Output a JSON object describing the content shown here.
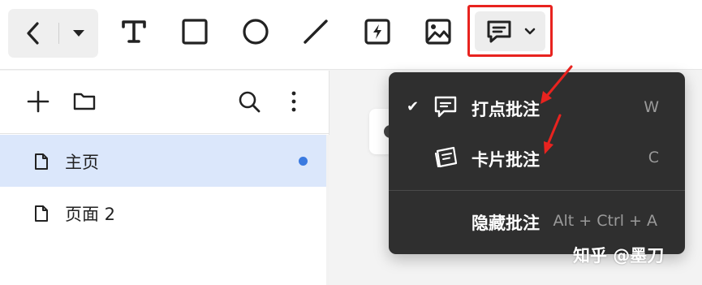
{
  "toolbar": {
    "tools": [
      {
        "icon": "text-tool-icon"
      },
      {
        "icon": "rectangle-tool-icon"
      },
      {
        "icon": "ellipse-tool-icon"
      },
      {
        "icon": "line-tool-icon"
      },
      {
        "icon": "component-tool-icon"
      },
      {
        "icon": "image-tool-icon"
      }
    ],
    "comment_tool": {
      "icon": "comment-icon",
      "dropdown_icon": "chevron-down-icon",
      "highlight_color": "#e8231f"
    }
  },
  "panel": {
    "pages": [
      {
        "label": "主页",
        "active": true,
        "has_indicator": true
      },
      {
        "label": "页面 2",
        "active": false,
        "has_indicator": false
      }
    ],
    "active_color": "#dbe7fb",
    "indicator_color": "#3a7ae0"
  },
  "menu": {
    "items": [
      {
        "label": "打点批注",
        "shortcut": "W",
        "checked": true,
        "check_glyph": "✔",
        "icon": "point-comment-icon"
      },
      {
        "label": "卡片批注",
        "shortcut": "C",
        "checked": false,
        "icon": "card-comment-icon"
      },
      {
        "label": "隐藏批注",
        "shortcut": "Alt + Ctrl + A",
        "checked": false
      }
    ],
    "background": "#2f2f2f"
  },
  "watermark": "知乎 @墨刀"
}
